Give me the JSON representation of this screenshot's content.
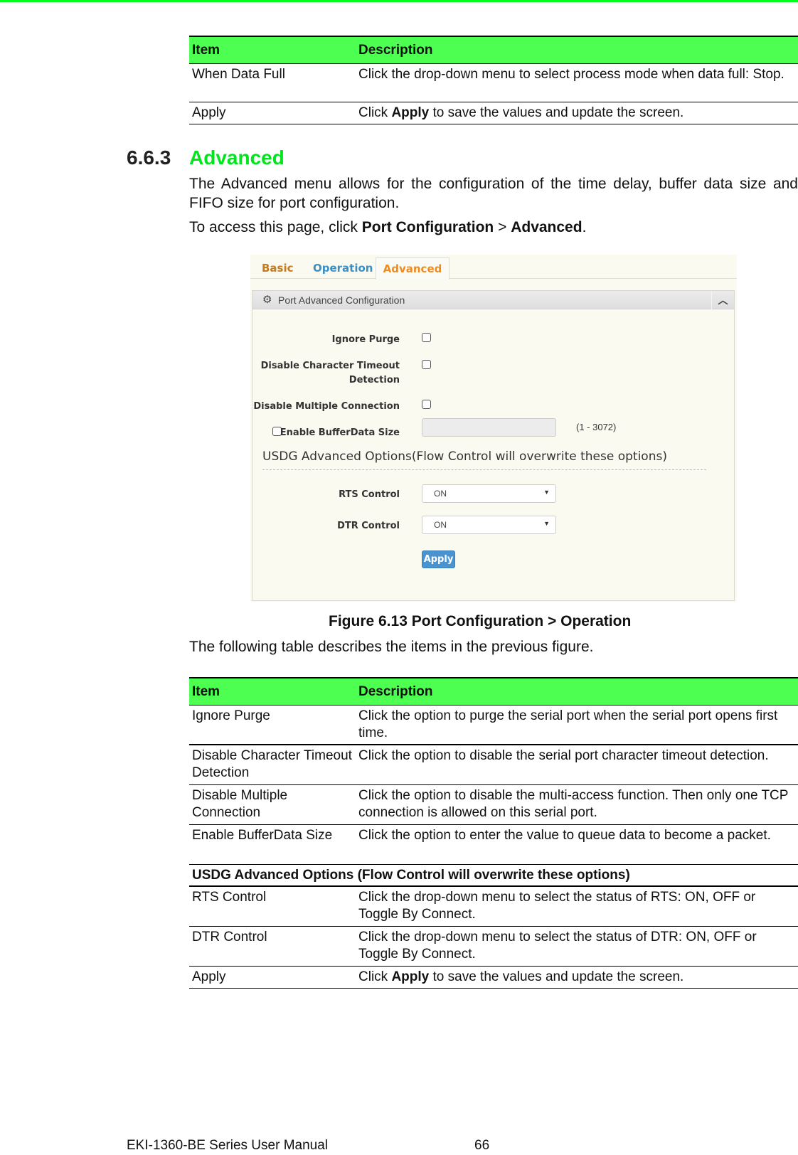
{
  "top_table": {
    "headers": [
      "Item",
      "Description"
    ],
    "rows": [
      {
        "item": "When Data Full",
        "desc": "Click the drop-down menu to select process mode when data full: Stop."
      },
      {
        "item": "Apply",
        "desc_pre": "Click ",
        "desc_bold": "Apply",
        "desc_post": " to save the values and update the screen."
      }
    ]
  },
  "section": {
    "number": "6.6.3",
    "title": "Advanced",
    "intro": "The Advanced menu allows for the configuration of the time delay, buffer data size and FIFO size for port configuration.",
    "access_pre": "To access this page, click ",
    "access_bold1": "Port Configuration",
    "access_mid": " > ",
    "access_bold2": "Advanced",
    "access_post": "."
  },
  "figure": {
    "tabs": [
      {
        "label": "Basic",
        "active": false,
        "color": "#c57a1f"
      },
      {
        "label": "Operation",
        "active": false,
        "color": "#3b8fc4"
      },
      {
        "label": "Advanced",
        "active": true,
        "color": "#ef8a1c"
      }
    ],
    "panel_title": "Port Advanced Configuration",
    "fields": {
      "ignore_purge": {
        "label": "Ignore Purge",
        "checked": false
      },
      "disable_char_timeout": {
        "label1": "Disable Character Timeout",
        "label2": "Detection",
        "checked": false
      },
      "disable_multiple": {
        "label": "Disable Multiple Connection",
        "checked": false
      },
      "enable_buffer": {
        "label": "Enable BufferData Size",
        "checked": false,
        "value": "",
        "range": "(1 - 3072)"
      }
    },
    "usdg_heading": "USDG Advanced Options(Flow Control will overwrite these options)",
    "rts": {
      "label": "RTS Control",
      "value": "ON"
    },
    "dtr": {
      "label": "DTR Control",
      "value": "ON"
    },
    "apply_label": "Apply",
    "caption": "Figure 6.13 Port Configuration > Operation"
  },
  "following_text": "The following table describes the items in the previous figure.",
  "main_table": {
    "headers": [
      "Item",
      "Description"
    ],
    "rows": [
      {
        "item": "Ignore Purge",
        "desc": "Click the option to purge the serial port when the serial port opens first time."
      },
      {
        "item": "Disable Character Timeout Detection",
        "desc": "Click the option to disable the serial port character timeout detection."
      },
      {
        "item": "Disable Multiple Connection",
        "desc": "Click the option to disable the multi-access function. Then only one TCP connection is allowed on this serial port."
      },
      {
        "item": "Enable BufferData Size",
        "desc": "Click the option to enter the value to queue data to become a packet."
      }
    ],
    "span_row": "USDG Advanced Options (Flow Control will overwrite these options)",
    "rows2": [
      {
        "item": "RTS Control",
        "desc": "Click the drop-down menu to select the status of RTS: ON, OFF or Toggle By Connect."
      },
      {
        "item": "DTR Control",
        "desc": "Click the drop-down menu to select the status of DTR: ON, OFF or Toggle By Connect."
      },
      {
        "item": "Apply",
        "desc_pre": "Click ",
        "desc_bold": "Apply",
        "desc_post": " to save the values and update the screen."
      }
    ]
  },
  "footer": {
    "manual": "EKI-1360-BE Series User Manual",
    "page": "66"
  }
}
